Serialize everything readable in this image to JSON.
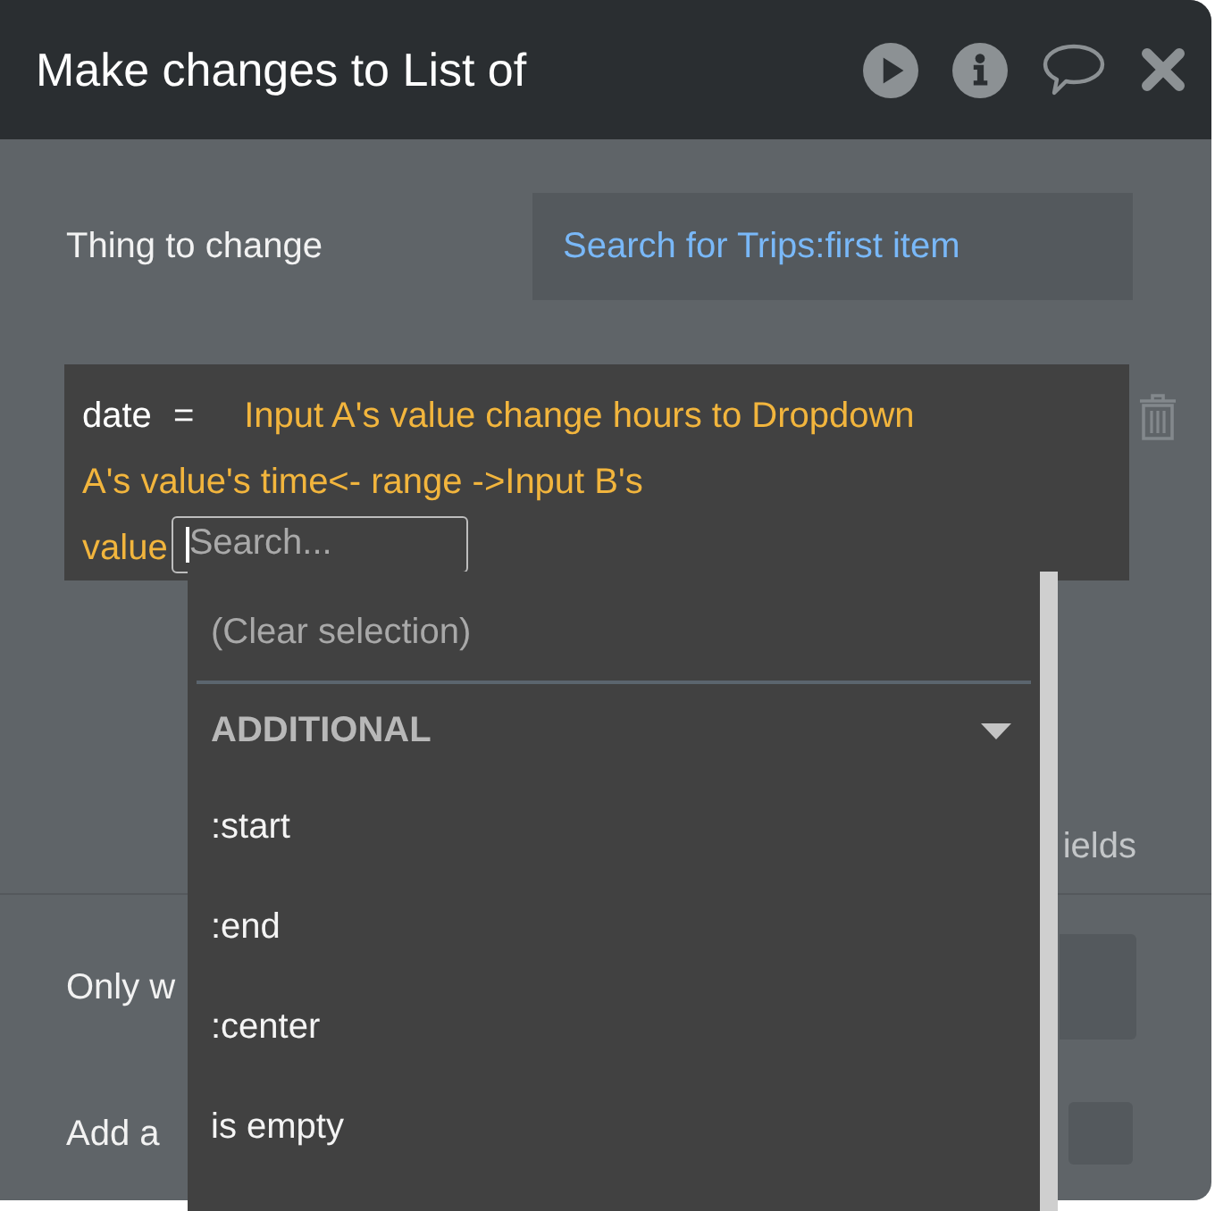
{
  "header": {
    "title": "Make changes to List of"
  },
  "thing_to_change": {
    "label": "Thing to change",
    "value": "Search for Trips:first item"
  },
  "field_assignment": {
    "field": "date",
    "operator": "=",
    "expression_lines": [
      "Input A's value change hours to Dropdown",
      "A's value's time<- range ->Input B's",
      "value"
    ]
  },
  "search": {
    "placeholder": "Search..."
  },
  "dropdown": {
    "clear_label": "(Clear selection)",
    "section": {
      "title": "ADDITIONAL",
      "expanded": true
    },
    "items": [
      ":start",
      ":end",
      ":center",
      "is empty"
    ]
  },
  "fields_link": "ields",
  "condition": {
    "label": "Only w"
  },
  "breakpoint": {
    "label": "Add a",
    "checked": false
  }
}
